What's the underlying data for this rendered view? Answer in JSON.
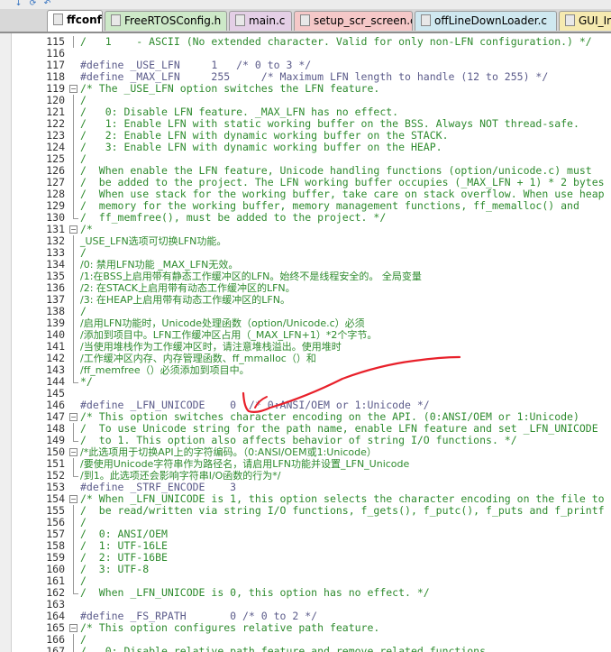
{
  "tabs": [
    {
      "label": "ffconf.h",
      "color": "#f2f2f2",
      "active": true
    },
    {
      "label": "FreeRTOSConfig.h",
      "color": "#cde9c8",
      "active": false
    },
    {
      "label": "main.c",
      "color": "#e4cfe6",
      "active": false
    },
    {
      "label": "setup_scr_screen.c",
      "color": "#f5c8c8",
      "active": false
    },
    {
      "label": "offLineDownLoader.c",
      "color": "#cfe8f0",
      "active": false
    },
    {
      "label": "GUI_In",
      "color": "#f6eab0",
      "active": false
    }
  ],
  "toolbar": {
    "buttons": [
      {
        "name": "toolbar-button-1",
        "glyph": "↓"
      },
      {
        "name": "toolbar-button-2",
        "glyph": "⟳"
      },
      {
        "name": "toolbar-button-3",
        "glyph": "↶"
      }
    ]
  },
  "editor": {
    "lines": [
      {
        "num": "115",
        "code": "/   1    - ASCII (No extended character. Valid for only non-LFN configuration.) */",
        "kind": "comment",
        "fold": "bar"
      },
      {
        "num": "116",
        "code": "",
        "kind": "comment",
        "fold": ""
      },
      {
        "num": "117",
        "code": "#define _USE_LFN     1   /* 0 to 3 */",
        "kind": "pp",
        "fold": ""
      },
      {
        "num": "118",
        "code": "#define _MAX_LFN     255     /* Maximum LFN length to handle (12 to 255) */",
        "kind": "pp",
        "fold": ""
      },
      {
        "num": "119",
        "code": "/* The _USE_LFN option switches the LFN feature.",
        "kind": "comment",
        "fold": "box"
      },
      {
        "num": "120",
        "code": "/",
        "kind": "comment",
        "fold": "bar"
      },
      {
        "num": "121",
        "code": "/   0: Disable LFN feature. _MAX_LFN has no effect.",
        "kind": "comment",
        "fold": "bar"
      },
      {
        "num": "122",
        "code": "/   1: Enable LFN with static working buffer on the BSS. Always NOT thread-safe.",
        "kind": "comment",
        "fold": "bar"
      },
      {
        "num": "123",
        "code": "/   2: Enable LFN with dynamic working buffer on the STACK.",
        "kind": "comment",
        "fold": "bar"
      },
      {
        "num": "124",
        "code": "/   3: Enable LFN with dynamic working buffer on the HEAP.",
        "kind": "comment",
        "fold": "bar"
      },
      {
        "num": "125",
        "code": "/",
        "kind": "comment",
        "fold": "bar"
      },
      {
        "num": "126",
        "code": "/  When enable the LFN feature, Unicode handling functions (option/unicode.c) must",
        "kind": "comment",
        "fold": "bar"
      },
      {
        "num": "127",
        "code": "/  be added to the project. The LFN working buffer occupies (_MAX_LFN + 1) * 2 bytes",
        "kind": "comment",
        "fold": "bar"
      },
      {
        "num": "128",
        "code": "/  When use stack for the working buffer, take care on stack overflow. When use heap",
        "kind": "comment",
        "fold": "bar"
      },
      {
        "num": "129",
        "code": "/  memory for the working buffer, memory management functions, ff_memalloc() and",
        "kind": "comment",
        "fold": "bar"
      },
      {
        "num": "130",
        "code": "/  ff_memfree(), must be added to the project. */",
        "kind": "comment",
        "fold": "end"
      },
      {
        "num": "131",
        "code": "/*",
        "kind": "comment",
        "fold": "box"
      },
      {
        "num": "132",
        "code": "_USE_LFN选项可切换LFN功能。",
        "kind": "cn",
        "fold": "bar"
      },
      {
        "num": "133",
        "code": "/",
        "kind": "comment",
        "fold": "bar"
      },
      {
        "num": "134",
        "code": "/0: 禁用LFN功能 _MAX_LFN无效。",
        "kind": "cn",
        "fold": "bar"
      },
      {
        "num": "135",
        "code": "/1:在BSS上启用带有静态工作缓冲区的LFN。始终不是线程安全的。 全局变量",
        "kind": "cn",
        "fold": "bar"
      },
      {
        "num": "136",
        "code": "/2: 在STACK上启用带有动态工作缓冲区的LFN。",
        "kind": "cn",
        "fold": "bar"
      },
      {
        "num": "137",
        "code": "/3: 在HEAP上启用带有动态工作缓冲区的LFN。",
        "kind": "cn",
        "fold": "bar"
      },
      {
        "num": "138",
        "code": "/",
        "kind": "comment",
        "fold": "bar"
      },
      {
        "num": "139",
        "code": "/启用LFN功能时，Unicode处理函数（option/Unicode.c）必须",
        "kind": "cn",
        "fold": "bar"
      },
      {
        "num": "140",
        "code": "/添加到项目中。LFN工作缓冲区占用（_MAX_LFN+1）*2个字节。",
        "kind": "cn",
        "fold": "bar"
      },
      {
        "num": "141",
        "code": "/当使用堆栈作为工作缓冲区时，请注意堆栈溢出。使用堆时",
        "kind": "cn",
        "fold": "bar"
      },
      {
        "num": "142",
        "code": "/工作缓冲区内存、内存管理函数、ff_mmalloc（）和",
        "kind": "cn",
        "fold": "bar"
      },
      {
        "num": "143",
        "code": "/ff_memfree（）必须添加到项目中。",
        "kind": "cn",
        "fold": "bar"
      },
      {
        "num": "144",
        "code": "*/",
        "kind": "comment",
        "fold": "end"
      },
      {
        "num": "145",
        "code": "",
        "kind": "comment",
        "fold": ""
      },
      {
        "num": "146",
        "code": "#define _LFN_UNICODE    0  /* 0:ANSI/OEM or 1:Unicode */",
        "kind": "pp",
        "fold": ""
      },
      {
        "num": "147",
        "code": "/* This option switches character encoding on the API. (0:ANSI/OEM or 1:Unicode)",
        "kind": "comment",
        "fold": "box"
      },
      {
        "num": "148",
        "code": "/  To use Unicode string for the path name, enable LFN feature and set _LFN_UNICODE",
        "kind": "comment",
        "fold": "bar"
      },
      {
        "num": "149",
        "code": "/  to 1. This option also affects behavior of string I/O functions. */",
        "kind": "comment",
        "fold": "end"
      },
      {
        "num": "150",
        "code": "/*此选项用于切换API上的字符编码。（0:ANSI/OEM或1:Unicode）",
        "kind": "cn",
        "fold": "box"
      },
      {
        "num": "151",
        "code": "/要使用Unicode字符串作为路径名，请启用LFN功能并设置_LFN_Unicode",
        "kind": "cn",
        "fold": "bar"
      },
      {
        "num": "152",
        "code": "/到1。此选项还会影响字符串I/O函数的行为*/",
        "kind": "cn",
        "fold": "end"
      },
      {
        "num": "153",
        "code": "#define _STRF_ENCODE    3",
        "kind": "pp",
        "fold": ""
      },
      {
        "num": "154",
        "code": "/* When _LFN_UNICODE is 1, this option selects the character encoding on the file to",
        "kind": "comment",
        "fold": "box"
      },
      {
        "num": "155",
        "code": "/  be read/written via string I/O functions, f_gets(), f_putc(), f_puts and f_printf",
        "kind": "comment",
        "fold": "bar"
      },
      {
        "num": "156",
        "code": "/",
        "kind": "comment",
        "fold": "bar"
      },
      {
        "num": "157",
        "code": "/  0: ANSI/OEM",
        "kind": "comment",
        "fold": "bar"
      },
      {
        "num": "158",
        "code": "/  1: UTF-16LE",
        "kind": "comment",
        "fold": "bar"
      },
      {
        "num": "159",
        "code": "/  2: UTF-16BE",
        "kind": "comment",
        "fold": "bar"
      },
      {
        "num": "160",
        "code": "/  3: UTF-8",
        "kind": "comment",
        "fold": "bar"
      },
      {
        "num": "161",
        "code": "/",
        "kind": "comment",
        "fold": "bar"
      },
      {
        "num": "162",
        "code": "/  When _LFN_UNICODE is 0, this option has no effect. */",
        "kind": "comment",
        "fold": "end"
      },
      {
        "num": "163",
        "code": "",
        "kind": "comment",
        "fold": ""
      },
      {
        "num": "164",
        "code": "#define _FS_RPATH       0 /* 0 to 2 */",
        "kind": "pp",
        "fold": ""
      },
      {
        "num": "165",
        "code": "/* This option configures relative path feature.",
        "kind": "comment",
        "fold": "box"
      },
      {
        "num": "166",
        "code": "/",
        "kind": "comment",
        "fold": "bar"
      },
      {
        "num": "167",
        "code": "/   0: Disable relative path feature and remove related functions.",
        "kind": "comment",
        "fold": "bar"
      }
    ]
  },
  "colors": {
    "annotation_stroke": "#e8202a",
    "comment_text": "#2e8b2e",
    "preprocessor_text": "#5b5b8a"
  }
}
